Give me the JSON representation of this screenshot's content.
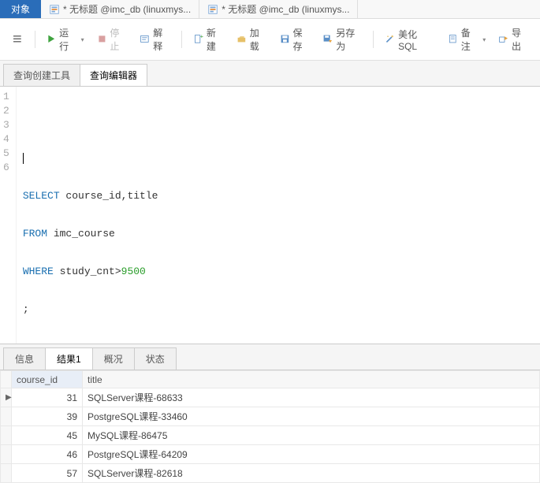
{
  "topbar": {
    "objectTab": "对象",
    "fileTabs": [
      {
        "label": "* 无标题 @imc_db (linuxmys..."
      },
      {
        "label": "* 无标题 @imc_db (linuxmys..."
      }
    ]
  },
  "toolbar": {
    "run": "运行",
    "stop": "停止",
    "explain": "解释",
    "new": "新建",
    "load": "加载",
    "save": "保存",
    "saveAs": "另存为",
    "beautify": "美化 SQL",
    "remark": "备注",
    "export": "导出"
  },
  "subTabs": {
    "queryBuilder": "查询创建工具",
    "queryEditor": "查询编辑器"
  },
  "editor": {
    "lineNumbers": [
      "1",
      "2",
      "3",
      "4",
      "5",
      "6"
    ],
    "code": {
      "l3a": "SELECT",
      "l3b": " course_id,title",
      "l4a": "FROM",
      "l4b": " imc_course",
      "l5a": "WHERE",
      "l5b": " study_cnt>",
      "l5c": "9500",
      "l6": ";"
    }
  },
  "resultTabs": {
    "info": "信息",
    "result1": "结果1",
    "profile": "概况",
    "status": "状态"
  },
  "grid": {
    "headers": {
      "course_id": "course_id",
      "title": "title"
    },
    "rows": [
      {
        "course_id": "31",
        "title": "SQLServer课程-68633"
      },
      {
        "course_id": "39",
        "title": "PostgreSQL课程-33460"
      },
      {
        "course_id": "45",
        "title": "MySQL课程-86475"
      },
      {
        "course_id": "46",
        "title": "PostgreSQL课程-64209"
      },
      {
        "course_id": "57",
        "title": "SQLServer课程-82618"
      }
    ]
  }
}
